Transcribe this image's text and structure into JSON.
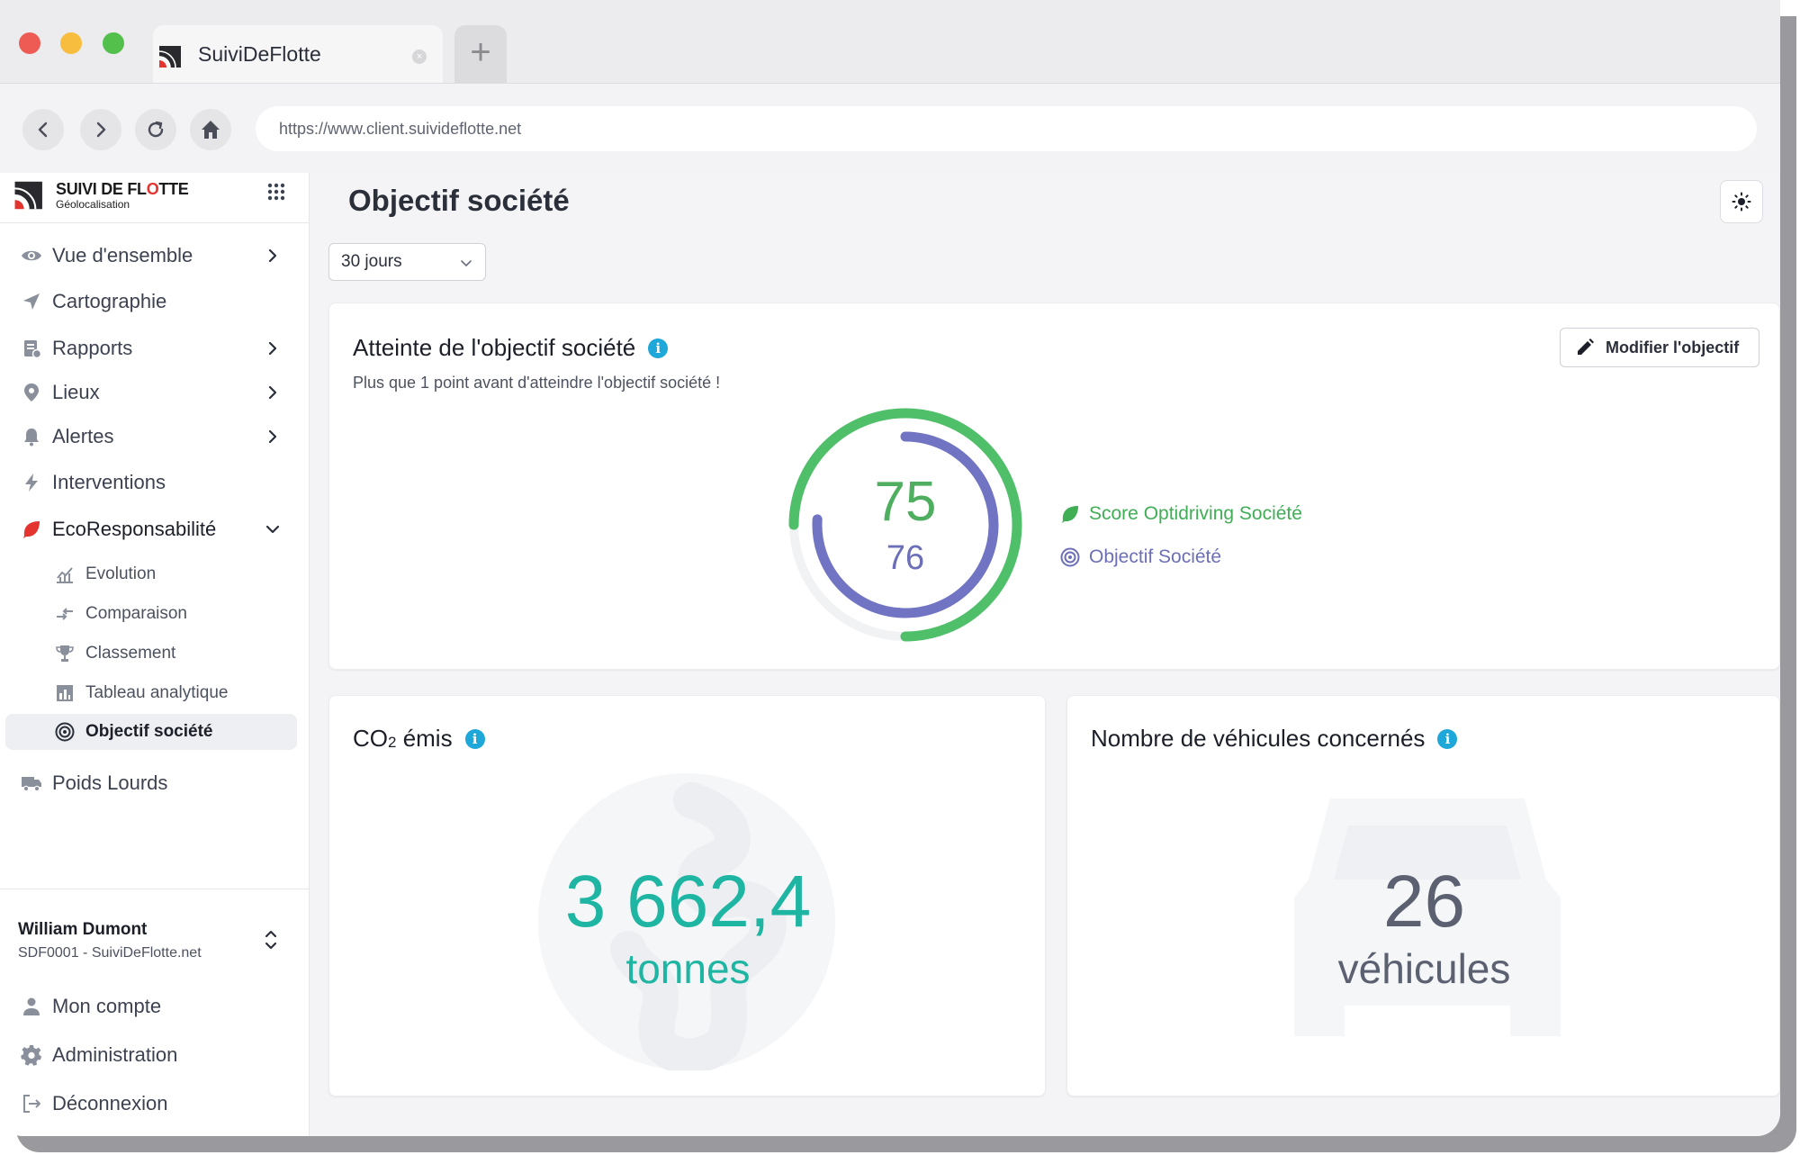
{
  "browser": {
    "tab_title": "SuiviDeFlotte",
    "url": "https://www.client.suivideflotte.net"
  },
  "brand": {
    "name_part1": "SUIVI DE FL",
    "name_part2": "O",
    "name_part3": "TTE",
    "subtitle": "Géolocalisation"
  },
  "sidebar": {
    "items": [
      {
        "label": "Vue d'ensemble",
        "icon": "eye-icon"
      },
      {
        "label": "Cartographie",
        "icon": "navigation-arrow-icon"
      },
      {
        "label": "Rapports",
        "icon": "report-icon"
      },
      {
        "label": "Lieux",
        "icon": "map-pin-icon"
      },
      {
        "label": "Alertes",
        "icon": "bell-icon"
      },
      {
        "label": "Interventions",
        "icon": "bolt-icon"
      },
      {
        "label": "EcoResponsabilité",
        "icon": "leaf-icon"
      },
      {
        "label": "Poids Lourds",
        "icon": "truck-icon"
      }
    ],
    "eco_subitems": [
      {
        "label": "Evolution",
        "icon": "line-chart-icon"
      },
      {
        "label": "Comparaison",
        "icon": "compare-arrows-icon"
      },
      {
        "label": "Classement",
        "icon": "trophy-icon"
      },
      {
        "label": "Tableau analytique",
        "icon": "bar-table-icon"
      },
      {
        "label": "Objectif société",
        "icon": "target-icon"
      }
    ],
    "user": {
      "name": "William Dumont",
      "org": "SDF0001 - SuiviDeFlotte.net"
    },
    "account_items": [
      {
        "label": "Mon compte",
        "icon": "user-icon"
      },
      {
        "label": "Administration",
        "icon": "gear-icon"
      },
      {
        "label": "Déconnexion",
        "icon": "logout-icon"
      }
    ]
  },
  "main": {
    "page_title": "Objectif société",
    "period": "30 jours",
    "objective_card": {
      "title": "Atteinte de l'objectif société",
      "subtitle": "Plus que 1 point avant d'atteindre l'objectif société !",
      "modify_label": "Modifier l'objectif",
      "score": 75,
      "target": 76,
      "score_fraction": 0.75,
      "target_fraction": 0.76,
      "legend_score": "Score Optidriving Société",
      "legend_target": "Objectif Société",
      "score_color": "#4fbf6a",
      "target_color": "#7174c2"
    },
    "co2_card": {
      "title_prefix": "CO",
      "title_sub": "2",
      "title_suffix": " émis",
      "value": "3 662,4",
      "unit": "tonnes"
    },
    "vehicles_card": {
      "title": "Nombre de véhicules concernés",
      "value": "26",
      "unit": "véhicules"
    }
  }
}
